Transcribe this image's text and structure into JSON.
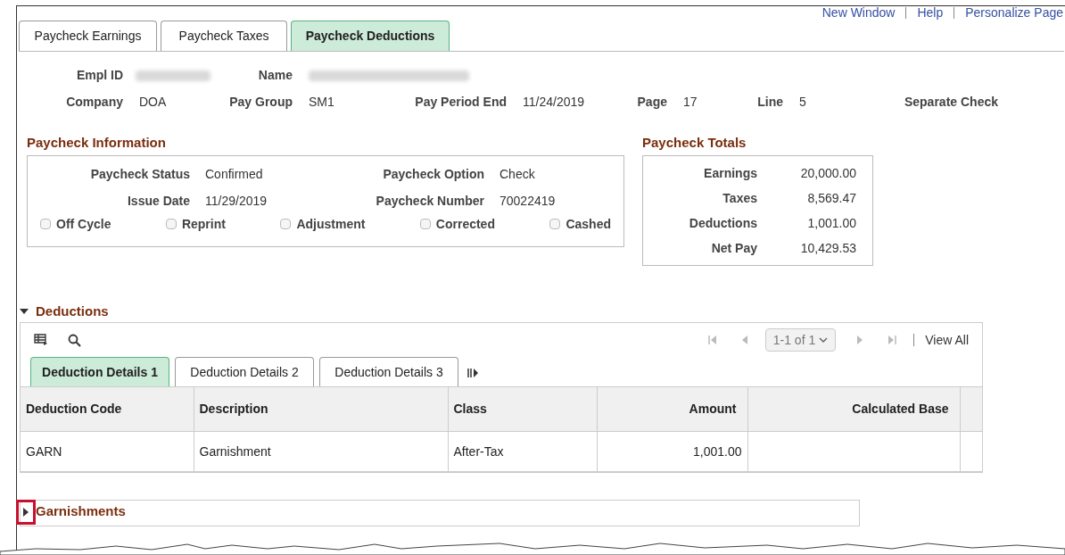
{
  "top_links": [
    "New Window",
    "Help",
    "Personalize Page"
  ],
  "tabs": [
    {
      "label": "Paycheck Earnings",
      "selected": false
    },
    {
      "label": "Paycheck Taxes",
      "selected": false
    },
    {
      "label": "Paycheck Deductions",
      "selected": true
    }
  ],
  "header": {
    "empl_id_label": "Empl ID",
    "name_label": "Name",
    "fields": [
      {
        "label": "Company",
        "value": "DOA"
      },
      {
        "label": "Pay Group",
        "value": "SM1"
      },
      {
        "label": "Pay Period End",
        "value": "11/24/2019"
      },
      {
        "label": "Page",
        "value": "17"
      },
      {
        "label": "Line",
        "value": "5"
      }
    ],
    "separate_check": "Separate Check"
  },
  "paycheck_information": {
    "title": "Paycheck Information",
    "fields": [
      {
        "label": "Paycheck Status",
        "value": "Confirmed"
      },
      {
        "label": "Paycheck Option",
        "value": "Check"
      },
      {
        "label": "Issue Date",
        "value": "11/29/2019"
      },
      {
        "label": "Paycheck Number",
        "value": "70022419"
      }
    ],
    "checkboxes": [
      {
        "label": "Off Cycle",
        "checked": false
      },
      {
        "label": "Reprint",
        "checked": false
      },
      {
        "label": "Adjustment",
        "checked": false
      },
      {
        "label": "Corrected",
        "checked": false
      },
      {
        "label": "Cashed",
        "checked": false
      }
    ]
  },
  "paycheck_totals": {
    "title": "Paycheck Totals",
    "rows": [
      {
        "label": "Earnings",
        "value": "20,000.00"
      },
      {
        "label": "Taxes",
        "value": "8,569.47"
      },
      {
        "label": "Deductions",
        "value": "1,001.00"
      },
      {
        "label": "Net Pay",
        "value": "10,429.53"
      }
    ]
  },
  "deductions": {
    "title": "Deductions",
    "expanded": true,
    "pager": "1-1 of 1",
    "view_all": "View All",
    "tabs": [
      {
        "label": "Deduction Details 1",
        "selected": true
      },
      {
        "label": "Deduction Details 2",
        "selected": false
      },
      {
        "label": "Deduction Details 3",
        "selected": false
      }
    ],
    "table": {
      "columns": [
        "Deduction Code",
        "Description",
        "Class",
        "Amount",
        "Calculated Base"
      ],
      "rows": [
        [
          "GARN",
          "Garnishment",
          "After-Tax",
          "1,001.00",
          ""
        ]
      ]
    }
  },
  "garnishments": {
    "title": "Garnishments",
    "expanded": false
  }
}
